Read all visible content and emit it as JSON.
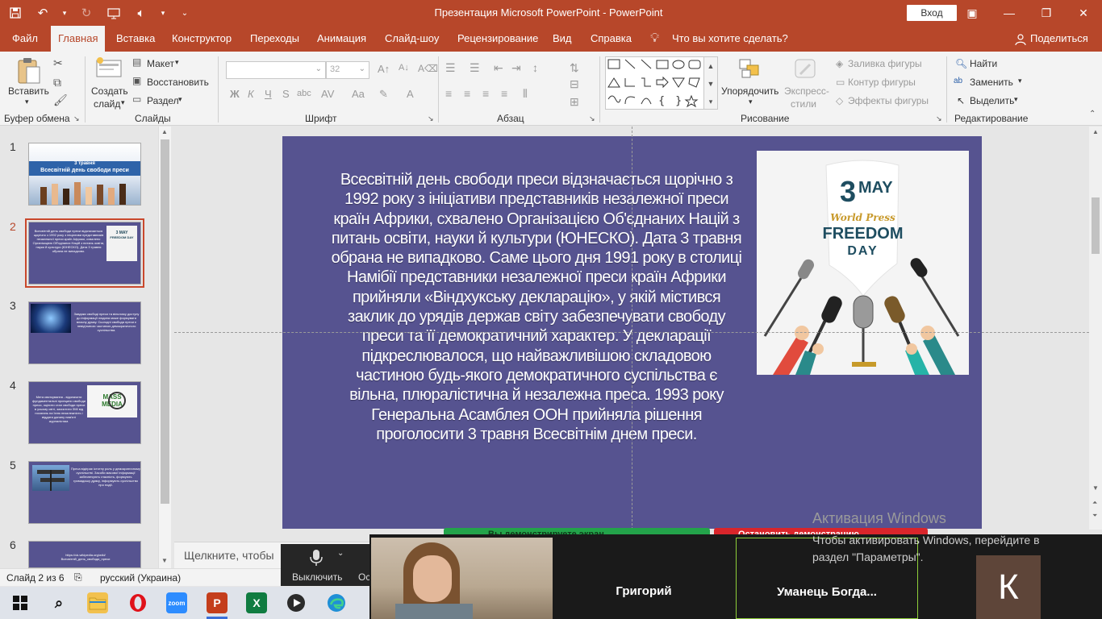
{
  "window": {
    "title": "Презентация Microsoft PowerPoint  -  PowerPoint",
    "login_label": "Вход",
    "minimize": "—",
    "maximize": "❐",
    "close": "✕",
    "ribbon_display": "▣"
  },
  "tabs": [
    "Файл",
    "Главная",
    "Вставка",
    "Конструктор",
    "Переходы",
    "Анимация",
    "Слайд-шоу",
    "Рецензирование",
    "Вид",
    "Справка",
    "Что вы хотите сделать?"
  ],
  "share_label": "Поделиться",
  "ribbon": {
    "clipboard": {
      "paste": "Вставить",
      "label": "Буфер обмена"
    },
    "slides": {
      "new_slide_1": "Создать",
      "new_slide_2": "слайд",
      "layout": "Макет",
      "reset": "Восстановить",
      "section": "Раздел",
      "label": "Слайды"
    },
    "font": {
      "size": "32",
      "bold": "Ж",
      "italic": "К",
      "underline": "Ч",
      "strike": "S",
      "shadow": "abc",
      "label": "Шрифт"
    },
    "paragraph": {
      "label": "Абзац"
    },
    "drawing": {
      "arrange_1": "Упорядочить",
      "quick_styles_1": "Экспресс-",
      "quick_styles_2": "стили",
      "fill": "Заливка фигуры",
      "outline": "Контур фигуры",
      "effects": "Эффекты фигуры",
      "label": "Рисование"
    },
    "editing": {
      "find": "Найти",
      "replace": "Заменить",
      "select": "Выделить",
      "label": "Редактирование"
    }
  },
  "slides_panel": {
    "numbers": [
      "1",
      "2",
      "3",
      "4",
      "5",
      "6"
    ],
    "thumb1_line1": "3 травня",
    "thumb1_line2": "Всесвітній день свободи преси",
    "thumb2_text": "Всесвітній день свободи преси відзначається щорічно з 1992 року з ініціативи представників незалежної преси країн Африки, схвалено Організацією Об'єднаних Націй з питань освіти, науки й культури (ЮНЕСКО). Дата 3 травня обрана не випадково.",
    "thumb3_text": "Завдяки свободі преси та вільному доступу до інформації людина може формувати власну думку. Сьогодні свобода преси є невід'ємною частиною демократичного суспільства.",
    "thumb4_logo_1": "MASS",
    "thumb4_logo_2": "MEDIA",
    "thumb4_text": "Мета святкування - відзначити фундаментальні принципи свободи преси, оцінити стан свободи преси в усьому світі, захистити ЗМІ від посягань на їхню незалежність і віддати данину пам'яті журналістам.",
    "thumb5_text": "Преса відіграє істотну роль у демократичному суспільстві. Засоби масової інформації забезпечують гласність, формують громадську думку, інформують суспільство про події.",
    "thumb6_text": "https://uk.wikipedia.org/wiki/Всесвітній_день_свободи_преси"
  },
  "slide": {
    "body": "Всесвітній день свободи преси відзначається щорічно з 1992 року з ініціативи представників незалежної преси країн Африки, схвалено Організацією Об'єднаних Націй з питань освіти, науки й культури (ЮНЕСКО). Дата 3 травня обрана не випадково. Саме цього дня 1991 року в столиці Намібії представники незалежної преси країн Африки прийняли «Віндхукську декларацію», у якій містився заклик до урядів держав світу забезпечувати свободу преси та її демократичний характер. У декларації підкреслювалося, що найважливішою складовою частиною будь-якого демократичного суспільства є вільна, плюралістична й незалежна преса. 1993 року Генеральна Асамблея ООН прийняла рішення проголосити 3 травня Всесвітнім днем преси.",
    "image_day": "3",
    "image_month": "MAY",
    "image_line1": "World Press",
    "image_line2": "FREEDOM",
    "image_line3": "DAY"
  },
  "notes_placeholder": "Щелкните, чтобы",
  "status": {
    "slide_count": "Слайд 2 из 6",
    "language": "русский (Украина)"
  },
  "zoom": {
    "share_bar_text": "Вы демонстрируете экран",
    "stop_bar_text": "Остановить демонстрацию",
    "mute_label": "Выключить",
    "mute_cut": "Ос",
    "participants": [
      "Григорий",
      "Уманець  Богда..."
    ],
    "avatar_letter": "К"
  },
  "activation": {
    "title": "Активация Windows",
    "subtitle": "Чтобы активировать Windows, перейдите в раздел \"Параметры\"."
  },
  "taskbar": {
    "zoom_label": "zoom",
    "excel_letter": "X",
    "ppt_letter": "P"
  },
  "colors": {
    "brand": "#b7472a",
    "slide_bg": "#565390",
    "zoom_green": "#23a34a",
    "zoom_red": "#d9252b"
  }
}
